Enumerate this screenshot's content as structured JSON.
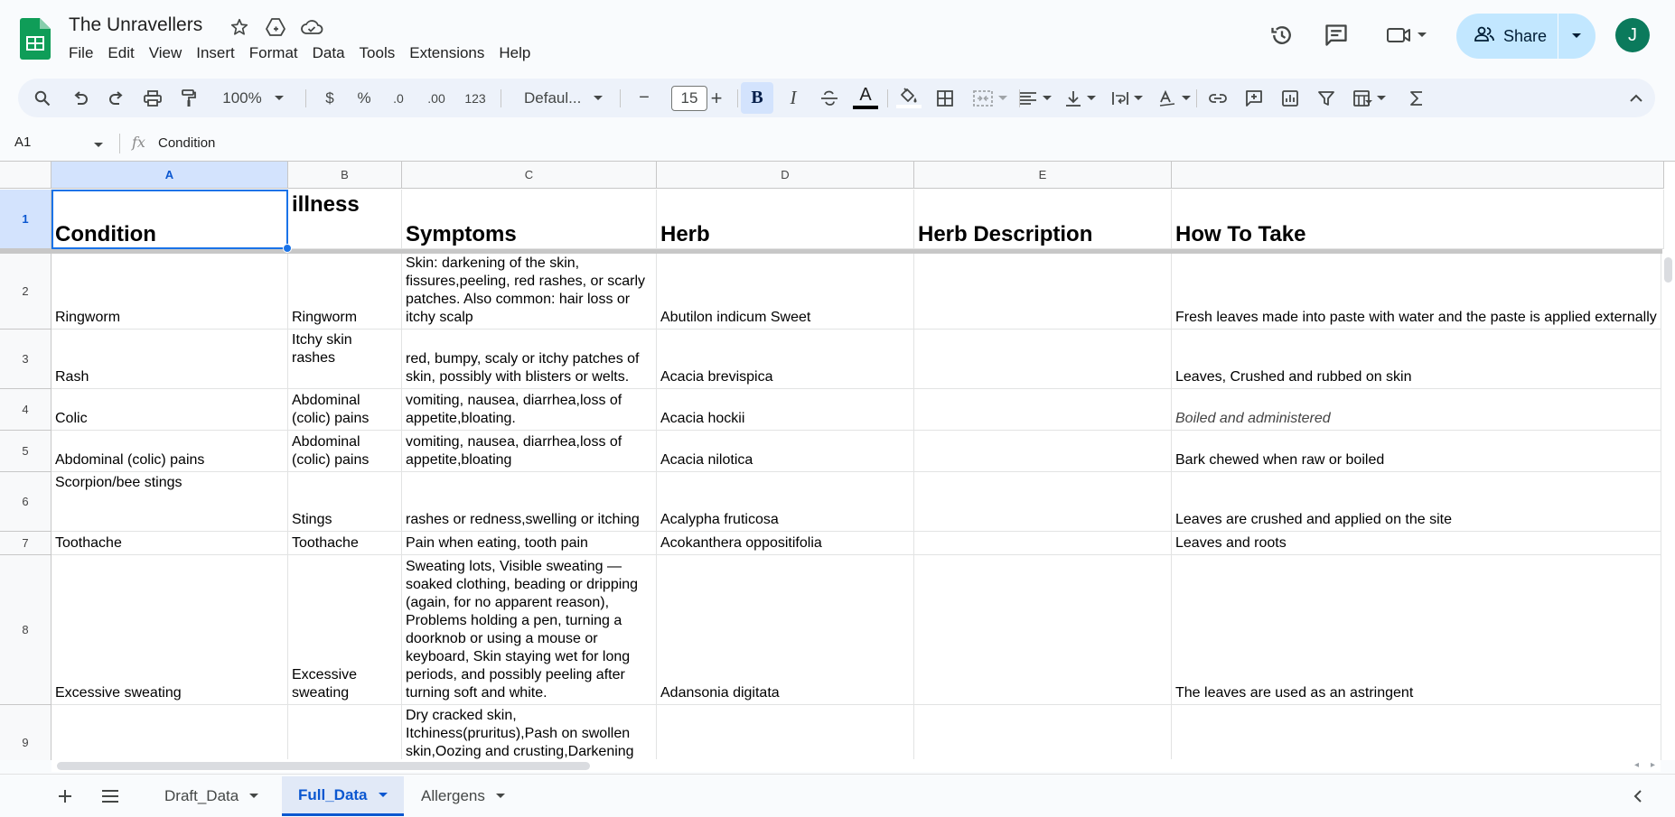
{
  "app": {
    "title": "The Unravellers"
  },
  "menu": [
    "File",
    "Edit",
    "View",
    "Insert",
    "Format",
    "Data",
    "Tools",
    "Extensions",
    "Help"
  ],
  "header_actions": {
    "share_label": "Share",
    "avatar_initial": "J"
  },
  "toolbar": {
    "zoom": "100%",
    "currency": "$",
    "percent": "%",
    "decrease_decimal": ".0",
    "increase_decimal": ".00",
    "number_format": "123",
    "font": "Defaul...",
    "font_size": "15",
    "minus": "−",
    "plus": "+",
    "bold": "B",
    "italic": "I",
    "text_color_letter": "A",
    "text_color": "#000000",
    "fill_color": "#ffffff"
  },
  "formula_bar": {
    "cell_ref": "A1",
    "fx": "fx",
    "content": "Condition"
  },
  "grid": {
    "columns": [
      "A",
      "B",
      "C",
      "D",
      "E",
      ""
    ],
    "selected_cell": "A1",
    "rows": [
      {
        "num": "1",
        "cells": [
          "Condition",
          "illness",
          "Symptoms",
          "Herb",
          "Herb Description",
          "How To Take"
        ]
      },
      {
        "num": "2",
        "cells": [
          "Ringworm",
          "Ringworm",
          "Skin: darkening of the skin, fissures,peeling, red rashes, or scarly patches. Also common: hair loss or itchy scalp",
          "Abutilon indicum Sweet",
          "",
          "Fresh leaves made into paste with water and the paste is applied externally"
        ]
      },
      {
        "num": "3",
        "cells": [
          "Rash",
          "Itchy skin rashes",
          "red, bumpy, scaly or itchy patches of skin, possibly with blisters or welts.",
          "Acacia brevispica",
          "",
          "Leaves, Crushed and rubbed on skin"
        ]
      },
      {
        "num": "4",
        "cells": [
          "Colic",
          "Abdominal (colic) pains",
          "vomiting, nausea, diarrhea,loss of appetite,bloating.",
          "Acacia hockii",
          "",
          "Boiled and administered"
        ]
      },
      {
        "num": "5",
        "cells": [
          "Abdominal (colic) pains",
          "Abdominal (colic) pains",
          "vomiting, nausea, diarrhea,loss of appetite,bloating",
          "Acacia nilotica",
          "",
          "Bark chewed when raw or boiled"
        ]
      },
      {
        "num": "6",
        "cells": [
          "Scorpion/bee stings",
          "Stings",
          "rashes or redness,swelling or itching",
          "Acalypha fruticosa",
          "",
          "Leaves are crushed and applied on the site"
        ]
      },
      {
        "num": "7",
        "cells": [
          "Toothache",
          "Toothache",
          "Pain when eating, tooth pain",
          "Acokanthera oppositifolia",
          "",
          "Leaves and roots"
        ]
      },
      {
        "num": "8",
        "cells": [
          "Excessive sweating",
          "Excessive sweating",
          "Sweating lots, Visible sweating — soaked clothing, beading or dripping (again, for no apparent reason), Problems holding a pen, turning a doorknob or using a mouse or keyboard, Skin staying wet for long periods, and possibly peeling after turning soft and white.",
          "Adansonia digitata",
          "",
          "The leaves are used as an astringent"
        ]
      },
      {
        "num": "9",
        "cells": [
          "",
          "",
          "Dry cracked skin, Itchiness(pruritus),Pash on swollen skin,Oozing and crusting,Darkening",
          "",
          "",
          ""
        ]
      }
    ]
  },
  "sheets": [
    {
      "name": "Draft_Data",
      "active": false
    },
    {
      "name": "Full_Data",
      "active": true
    },
    {
      "name": "Allergens",
      "active": false
    }
  ],
  "colors": {
    "accent": "#0b57d0",
    "share_bg": "#c2e7ff",
    "avatar_bg": "#0b7a5c",
    "sheets_green": "#0f9d58"
  }
}
